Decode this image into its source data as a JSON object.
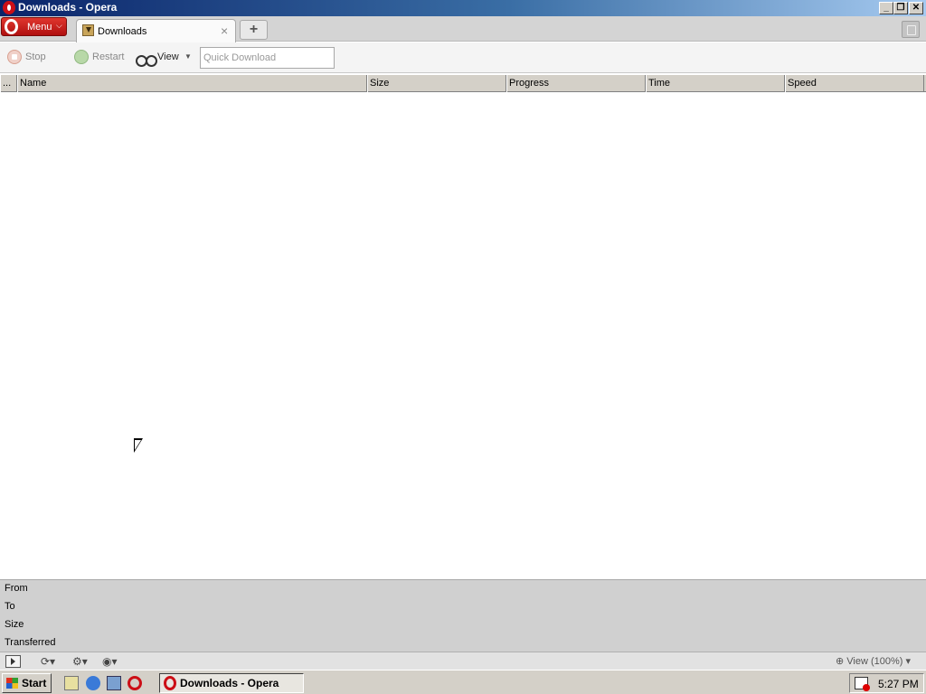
{
  "window": {
    "title": "Downloads - Opera"
  },
  "tabstrip": {
    "menu_label": "Menu",
    "tab_label": "Downloads",
    "tab_close": "×",
    "new_tab": "+"
  },
  "toolbar": {
    "stop_label": "Stop",
    "restart_label": "Restart",
    "view_label": "View",
    "quick_download_placeholder": "Quick Download"
  },
  "columns": [
    "...",
    "Name",
    "Size",
    "Progress",
    "Time",
    "Speed"
  ],
  "details": {
    "from_label": "From",
    "to_label": "To",
    "size_label": "Size",
    "transferred_label": "Transferred"
  },
  "statusbar": {
    "zoom_label": "View (100%)"
  },
  "taskbar": {
    "start_label": "Start",
    "task_label": "Downloads - Opera",
    "clock": "5:27 PM"
  },
  "colors": {
    "opera_red": "#cc0f16",
    "title_blue": "#0a246a"
  }
}
